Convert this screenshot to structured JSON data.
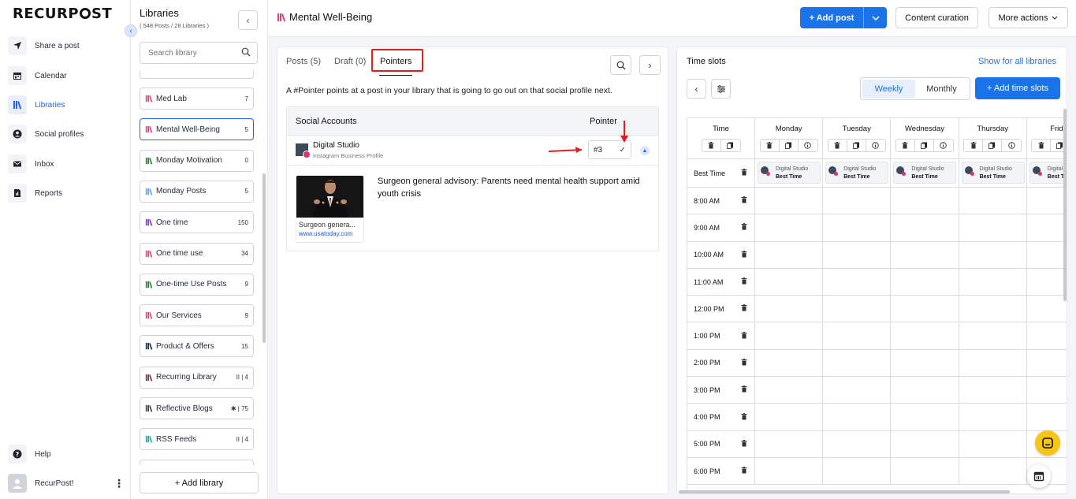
{
  "brand": {
    "logo_left": "RECURP",
    "logo_right": "ST"
  },
  "nav": {
    "items": [
      {
        "label": "Share a post",
        "icon": "send-icon"
      },
      {
        "label": "Calendar",
        "icon": "calendar-icon"
      },
      {
        "label": "Libraries",
        "icon": "library-icon",
        "active": true
      },
      {
        "label": "Social profiles",
        "icon": "profile-icon"
      },
      {
        "label": "Inbox",
        "icon": "inbox-icon"
      },
      {
        "label": "Reports",
        "icon": "reports-icon"
      }
    ],
    "help": "Help",
    "user": "RecurPost!"
  },
  "libraries": {
    "title": "Libraries",
    "subtitle": "( 548 Posts / 28 Libraries )",
    "search_placeholder": "Search library",
    "items": [
      {
        "name": "Med Lab",
        "count": "7",
        "color": "#d9467f"
      },
      {
        "name": "Mental Well-Being",
        "count": "5",
        "color": "#d9467f",
        "active": true
      },
      {
        "name": "Monday Motivation",
        "count": "0",
        "color": "#2e7d32"
      },
      {
        "name": "Monday Posts",
        "count": "5",
        "color": "#6d9eeb"
      },
      {
        "name": "One time",
        "count": "150",
        "color": "#7e3fb5"
      },
      {
        "name": "One time use",
        "count": "34",
        "color": "#d9467f"
      },
      {
        "name": "One-time Use Posts",
        "count": "9",
        "color": "#2e7d32"
      },
      {
        "name": "Our Services",
        "count": "9",
        "color": "#d9467f"
      },
      {
        "name": "Product & Offers",
        "count": "15",
        "color": "#1e2a4a"
      },
      {
        "name": "Recurring Library",
        "count": "II | 4",
        "color": "#6b3a3a"
      },
      {
        "name": "Reflective Blogs",
        "count": "✱ | 75",
        "color": "#444444"
      },
      {
        "name": "RSS Feeds",
        "count": "II | 4",
        "color": "#26a69a"
      }
    ],
    "add_label": "+ Add library"
  },
  "topbar": {
    "title": "Mental Well-Being",
    "add_post": "+ Add post",
    "content_curation": "Content curation",
    "more_actions": "More actions"
  },
  "pointers": {
    "tabs": [
      "Posts (5)",
      "Draft (0)",
      "Pointers"
    ],
    "description": "A #Pointer points at a post in your library that is going to go out on that social profile next.",
    "col_accounts": "Social Accounts",
    "col_pointer": "Pointer",
    "account_name": "Digital Studio",
    "account_type": "Instagram Business Profile",
    "pointer_value": "#3",
    "post_title": "Surgeon genera...",
    "post_link": "www.usatoday.com",
    "post_text": "Surgeon general advisory: Parents need mental health support amid youth crisis"
  },
  "timeslots": {
    "title": "Time slots",
    "show_all": "Show for all libraries",
    "view_weekly": "Weekly",
    "view_monthly": "Monthly",
    "add_label": "+ Add time slots",
    "time_header": "Time",
    "days": [
      "Monday",
      "Tuesday",
      "Wednesday",
      "Thursday",
      "Friday"
    ],
    "best_time_label": "Best Time",
    "chip_name": "Digital Studio",
    "chip_best": "Best Time",
    "times": [
      "8:00 AM",
      "9:00 AM",
      "10:00 AM",
      "11:00 AM",
      "12:00 PM",
      "1:00 PM",
      "2:00 PM",
      "3:00 PM",
      "4:00 PM",
      "5:00 PM",
      "6:00 PM"
    ]
  },
  "colors": {
    "accent": "#1a73e8",
    "highlight": "#e11d1d",
    "chat": "#f5c518"
  }
}
